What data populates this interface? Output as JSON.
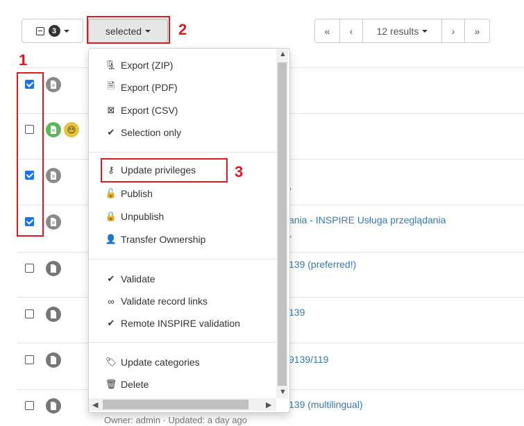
{
  "toolbar": {
    "select_count": "3",
    "selected_label": "selected",
    "pager": {
      "first": "«",
      "prev": "‹",
      "results_label": "12 results",
      "next": "›",
      "last": "»"
    }
  },
  "annotations": {
    "checkboxes_number": "1",
    "selected_number": "2",
    "privileges_number": "3",
    "color": "#e0191f"
  },
  "menu": {
    "group1": [
      {
        "icon": "zip-file-icon",
        "label": "Export (ZIP)"
      },
      {
        "icon": "pdf-file-icon",
        "label": "Export (PDF)"
      },
      {
        "icon": "csv-file-icon",
        "label": "Export (CSV)"
      },
      {
        "icon": "check-icon",
        "label": "Selection only"
      }
    ],
    "group2": [
      {
        "icon": "key-icon",
        "label": "Update privileges"
      },
      {
        "icon": "unlock-icon",
        "label": "Publish"
      },
      {
        "icon": "lock-icon",
        "label": "Unpublish"
      },
      {
        "icon": "user-icon",
        "label": "Transfer Ownership"
      }
    ],
    "group3": [
      {
        "icon": "check-icon",
        "label": "Validate"
      },
      {
        "icon": "link-icon",
        "label": "Validate record links"
      },
      {
        "icon": "check-icon",
        "label": "Remote INSPIRE validation"
      }
    ],
    "group4": [
      {
        "icon": "tags-icon",
        "label": "Update categories"
      },
      {
        "icon": "trash-icon",
        "label": "Delete"
      }
    ]
  },
  "rows": [
    {
      "checked": true,
      "title": "",
      "meta": ""
    },
    {
      "checked": false,
      "title": "",
      "meta": ""
    },
    {
      "checked": true,
      "title": "",
      "meta": "›"
    },
    {
      "checked": true,
      "title": "ania - INSPIRE Usługa przeglądania",
      "meta": "›"
    },
    {
      "checked": false,
      "title": "139 (preferred!)",
      "meta": ""
    },
    {
      "checked": false,
      "title": "139",
      "meta": ""
    },
    {
      "checked": false,
      "title": "9139/119",
      "meta": ""
    },
    {
      "checked": false,
      "title": "139 (multilingual)",
      "meta": ""
    }
  ],
  "last_row_meta": "Owner: admin · Updated: a day ago",
  "colors": {
    "link": "#337ab7",
    "checkbox_checked": "#1a73e8",
    "icon_gray": "#8a8a8a",
    "icon_green": "#5cb85c"
  }
}
